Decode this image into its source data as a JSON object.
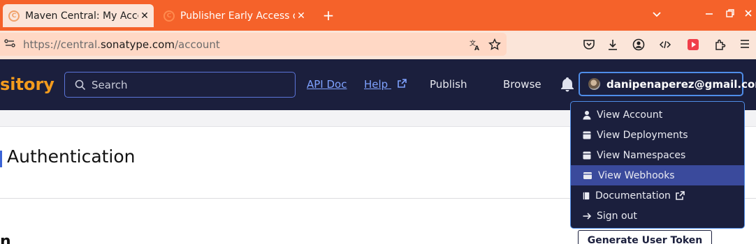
{
  "browser": {
    "tabs": [
      {
        "title": "Maven Central: My Accou",
        "active": true
      },
      {
        "title": "Publisher Early Access on",
        "active": false
      }
    ],
    "new_tab_glyph": "+",
    "close_glyph": "✕",
    "url": {
      "prefix": "https://central.",
      "domain": "sonatype.com",
      "path": "/account"
    },
    "icons": [
      "site-info-icon",
      "translate-icon",
      "bookmark-star-icon",
      "pocket-icon",
      "download-icon",
      "account-icon",
      "devtools-icon",
      "youtube-extension-icon",
      "extensions-icon",
      "menu-icon"
    ],
    "window_controls": [
      "minimize",
      "restore",
      "close"
    ]
  },
  "header": {
    "brand": "sitory",
    "search_placeholder": "Search",
    "links": {
      "api_doc": "API Doc",
      "help": "Help",
      "publish": "Publish",
      "browse": "Browse"
    },
    "user": "danipenaperez@gmail.com"
  },
  "dropdown": {
    "items": [
      {
        "label": "View Account",
        "icon": "user-icon"
      },
      {
        "label": "View Deployments",
        "icon": "package-icon"
      },
      {
        "label": "View Namespaces",
        "icon": "package-icon"
      },
      {
        "label": "View Webhooks",
        "icon": "browser-window-icon",
        "highlighted": true
      },
      {
        "label": "Documentation",
        "icon": "book-icon",
        "external": true
      },
      {
        "label": "Sign out",
        "icon": "arrow-right-icon"
      }
    ]
  },
  "page": {
    "title": "Authentication",
    "partial_heading_char": "n",
    "generate_token_button": "Generate User Token"
  },
  "colors": {
    "tabstrip": "#f5622a",
    "header_bg": "#1b1f3d",
    "brand": "#f39b1d",
    "link": "#7fa2ff",
    "accent_border": "#4f8de8",
    "menu_highlight": "#3a4a9c"
  }
}
